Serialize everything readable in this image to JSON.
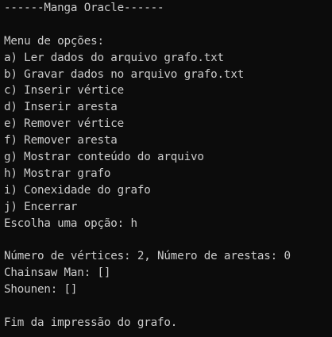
{
  "header": "------Manga Oracle------",
  "menu": {
    "title": "Menu de opções:",
    "items": [
      "a) Ler dados do arquivo grafo.txt",
      "b) Gravar dados no arquivo grafo.txt",
      "c) Inserir vértice",
      "d) Inserir aresta",
      "e) Remover vértice",
      "f) Remover aresta",
      "g) Mostrar conteúdo do arquivo",
      "h) Mostrar grafo",
      "i) Conexidade do grafo",
      "j) Encerrar"
    ],
    "prompt": "Escolha uma opção: h"
  },
  "output": {
    "summary": "Número de vértices: 2, Número de arestas: 0",
    "vertices": [
      "Chainsaw Man: []",
      "Shounen: []"
    ],
    "footer": "Fim da impressão do grafo."
  }
}
